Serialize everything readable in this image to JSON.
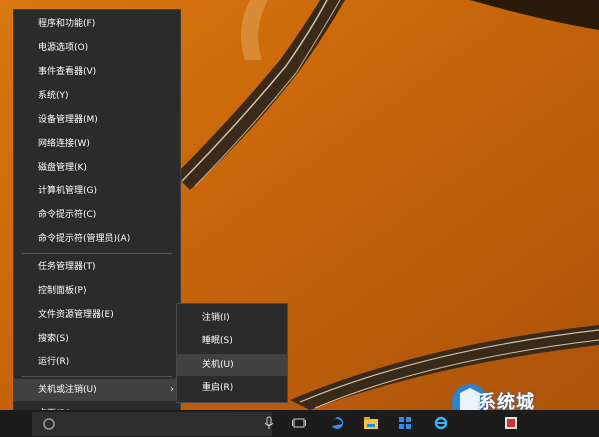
{
  "context_menu": {
    "items": [
      {
        "label": "程序和功能(F)"
      },
      {
        "label": "电源选项(O)"
      },
      {
        "label": "事件查看器(V)"
      },
      {
        "label": "系统(Y)"
      },
      {
        "label": "设备管理器(M)"
      },
      {
        "label": "网络连接(W)"
      },
      {
        "label": "磁盘管理(K)"
      },
      {
        "label": "计算机管理(G)"
      },
      {
        "label": "命令提示符(C)"
      },
      {
        "label": "命令提示符(管理员)(A)"
      },
      {
        "label": "任务管理器(T)"
      },
      {
        "label": "控制面板(P)"
      },
      {
        "label": "文件资源管理器(E)"
      },
      {
        "label": "搜索(S)"
      },
      {
        "label": "运行(R)"
      },
      {
        "label": "关机或注销(U)",
        "highlighted": true,
        "has_submenu": true
      },
      {
        "label": "桌面(D)"
      }
    ]
  },
  "submenu": {
    "items": [
      {
        "label": "注销(I)"
      },
      {
        "label": "睡眠(S)"
      },
      {
        "label": "关机(U)",
        "highlighted": true
      },
      {
        "label": "重启(R)"
      }
    ]
  },
  "taskbar": {
    "icons": [
      "start-icon",
      "microphone-icon",
      "task-view-icon",
      "edge-icon",
      "file-explorer-icon",
      "store-icon",
      "internet-explorer-icon",
      "app-icon"
    ]
  },
  "watermark": {
    "text": "系统城"
  },
  "colors": {
    "menu_bg": "#2b2b2b",
    "highlight": "#414141",
    "taskbar": "#1c1c1c",
    "accent": "#1e88e5"
  }
}
